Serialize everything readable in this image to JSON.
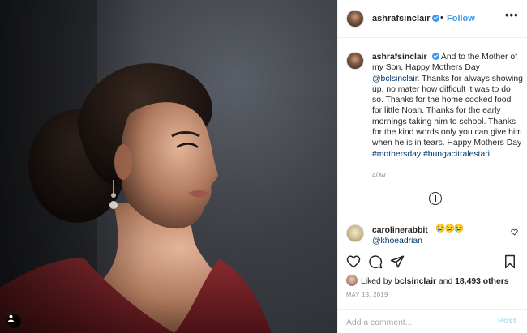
{
  "post": {
    "image_alt": "portrait photo",
    "header": {
      "username": "ashrafsinclair",
      "separator": "•",
      "follow_label": "Follow",
      "more_label": "•••"
    },
    "caption": {
      "username": "ashrafsinclair",
      "text_1": "And to the Mother of my Son, Happy Mothers Day ",
      "mention": "@bclsinclair",
      "text_2": ". Thanks for always showing up, no mater how difficult it was to do so. Thanks for the home cooked food for little Noah. Thanks for the early mornings taking him to school. Thanks for the kind words only you can give him when he is in tears. Happy Mothers Day ",
      "hashtag_1": "#mothersday",
      "hashtag_2": "#bungacitralestari",
      "age": "40w"
    },
    "comments": [
      {
        "username": "carolinerabbit",
        "emojis": "😢😢😢",
        "text": "@khoeadrian"
      }
    ],
    "likes": {
      "prefix": "Liked by",
      "user": "bclsinclair",
      "and": "and",
      "count": "18,493 others"
    },
    "date": "MAY 13, 2019",
    "add_comment": {
      "placeholder": "Add a comment...",
      "post_label": "Post"
    }
  },
  "colors": {
    "link_blue": "#3897f0",
    "mention_navy": "#003569",
    "muted_gray": "#8e8e8e",
    "post_disabled": "#b2dffc",
    "dress_red": "#7a1f24"
  }
}
